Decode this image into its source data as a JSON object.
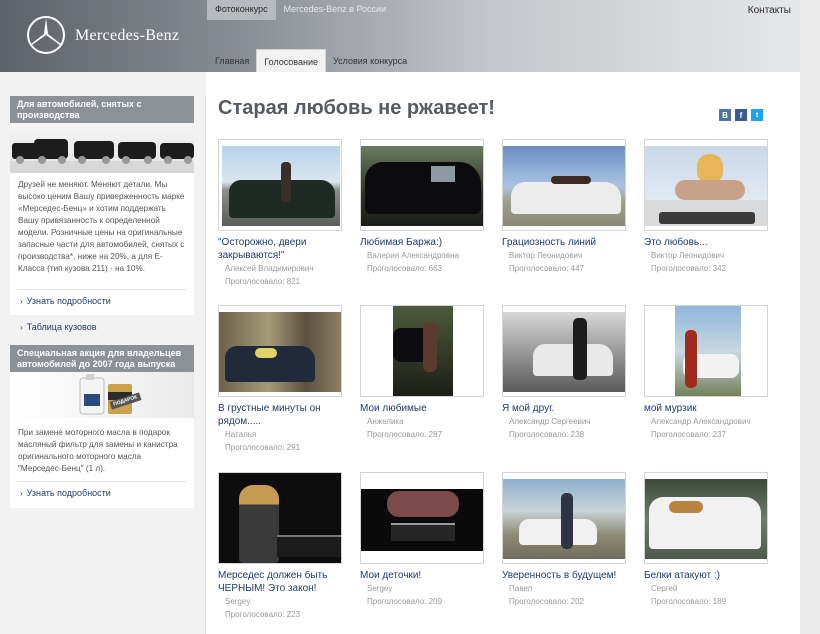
{
  "header": {
    "brand": "Mercedes-Benz",
    "topnav": [
      "Фотоконкурс",
      "Mercedes-Benz в России"
    ],
    "contacts": "Контакты",
    "subnav": [
      "Главная",
      "Голосование",
      "Условия конкурса"
    ]
  },
  "sidebar": {
    "box1": {
      "title": "Для автомобилей, снятых с производства",
      "text": "Друзей не меняют. Меняют детали. Мы высоко ценим Вашу приверженность марке «Мерседес-Бенц» и хотим поддержать Вашу привязанность к определенной модели. Розничные цены на оригинальные запасные части для автомобилей, снятых с производства*, ниже на 20%, а для E-Класса (тип кузова 211) - на 10%.",
      "link": "Узнать подробности"
    },
    "body_table_link": "Таблица кузовов",
    "box2": {
      "title": "Специальная акция для владельцев автомобилей до 2007 года выпуска",
      "text": "При замене моторного масла в подарок масляный фильтр для замены и канистра оригинального моторного масла \"Мерседес-Бенц\" (1 л).",
      "link": "Узнать подробности",
      "badge": "ПОДАРОК"
    }
  },
  "main": {
    "title": "Старая любовь не ржавеет!",
    "social": [
      "В",
      "f",
      "t"
    ],
    "cards": [
      {
        "title": "\"Осторожно, двери закрываются!\"",
        "author": "Алексей Владимирович",
        "votes": "Проголосовало: 821"
      },
      {
        "title": "Любимая Баржа:)",
        "author": "Валерия Александровна",
        "votes": "Проголосовало: 663"
      },
      {
        "title": "Грациозность линий",
        "author": "Виктор Леонидович",
        "votes": "Проголосовало: 447"
      },
      {
        "title": "Это любовь...",
        "author": "Виктор Леонидович",
        "votes": "Проголосовало: 342"
      },
      {
        "title": "В грустные минуты он рядом.....",
        "author": "Наталья",
        "votes": "Проголосовало: 291"
      },
      {
        "title": "Мои любимые",
        "author": "Анжелика",
        "votes": "Проголосовало: 287"
      },
      {
        "title": "Я мой друг.",
        "author": "Александр Сергеевич",
        "votes": "Проголосовало: 238"
      },
      {
        "title": "мой мурзик",
        "author": "Александр Александрович",
        "votes": "Проголосовало: 237"
      },
      {
        "title": "Мерседес должен быть ЧЕРНЫМ! Это закон!",
        "author": "Sergey",
        "votes": "Проголосовало: 223"
      },
      {
        "title": "Мои деточки!",
        "author": "Sergey",
        "votes": "Проголосовало: 209"
      },
      {
        "title": "Уверенность в будущем!",
        "author": "Павел",
        "votes": "Проголосовало: 202"
      },
      {
        "title": "Белки атакуют :)",
        "author": "Сергей",
        "votes": "Проголосовало: 189"
      }
    ]
  },
  "colors": {
    "link": "#1d3c6e",
    "sidebar_header": "#8c9198",
    "vk": "#4c75a3",
    "facebook": "#3b5998",
    "twitter": "#1da1f2"
  }
}
